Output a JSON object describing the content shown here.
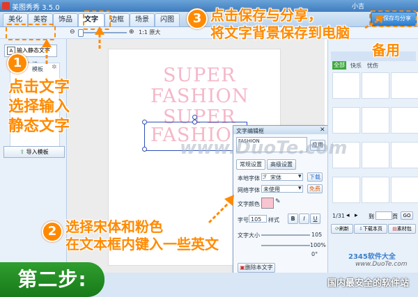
{
  "app": {
    "title": "美图秀秀 3.5.0",
    "user": "小吉"
  },
  "tabs": [
    "美化",
    "美容",
    "饰品",
    "文字",
    "边框",
    "场景",
    "闪图"
  ],
  "active_tab": "文字",
  "toolbar": {
    "zoom_label": "1:1 原大"
  },
  "left_panel": {
    "input_static_btn": "输入静态文字",
    "input_template_label": "输入模",
    "tab_label": "模板",
    "import_template_btn": "导入模板"
  },
  "canvas_text": [
    "SUPER",
    "FASHION",
    "SUPER",
    "FASHION"
  ],
  "editor": {
    "title": "文字编辑框",
    "text_value": "FASHION",
    "apply_btn": "应用",
    "tab_common": "常规设置",
    "tab_advanced": "高级设置",
    "local_font_label": "本地字体",
    "local_font_value": "宋体",
    "download_btn": "下载",
    "web_font_label": "网络字体",
    "web_font_value": "未使用",
    "free_badge": "免费",
    "color_label": "文字颜色",
    "color_value": "#f7c4cf",
    "size_label": "字号",
    "size_value": "105",
    "style_label": "样式",
    "style_b": "B",
    "style_i": "I",
    "style_u": "U",
    "text_size_label": "文字大小",
    "text_size_value": "105",
    "opacity_value": "100%",
    "rotate_value": "0°",
    "delete_btn": "删除本文字"
  },
  "right_panel": {
    "save_share_btn": "保存与分享",
    "sub_tabs": [
      "全部",
      "快乐",
      "忧伤"
    ],
    "pager": "1/31",
    "goto_label": "到",
    "page_unit": "页",
    "go_btn": "GO",
    "refresh_btn": "刷新",
    "download_page_btn": "下载本页",
    "material_btn": "素材包"
  },
  "annotations": {
    "step1_num": "1",
    "step1_text": [
      "点击文字",
      "选择输入",
      "静态文字"
    ],
    "step2_num": "2",
    "step2_text": [
      "选择宋体和粉色",
      "在文本框内键入一些英文"
    ],
    "step3_num": "3",
    "step3_text": [
      "点击保存与分享，",
      "将文字背景保存到电脑",
      "备用"
    ],
    "step_label": "第二步:"
  },
  "watermarks": {
    "center": "www.DuoTe.com",
    "corner_brand": "2345软件大全",
    "corner_url": "www.DuoTe.com",
    "corner_slogan": "国内最安全的软件站"
  }
}
